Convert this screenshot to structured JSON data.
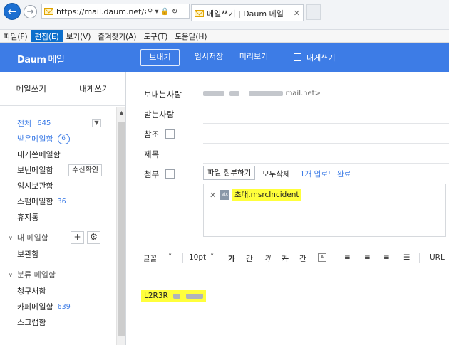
{
  "browser": {
    "address_url": "https://mail.daum.net/#?comp",
    "tab_title": "메일쓰기 | Daum 메일",
    "menu": [
      "파일(F)",
      "편집(E)",
      "보기(V)",
      "즐겨찾기(A)",
      "도구(T)",
      "도움말(H)"
    ],
    "active_menu_index": 1
  },
  "header": {
    "logo": "Daum",
    "logo_suffix": "메일",
    "send": "보내기",
    "save_draft": "임시저장",
    "preview": "미리보기",
    "send_to_self": "내게쓰기"
  },
  "sidebar": {
    "write_mail": "메일쓰기",
    "write_to_self": "내게쓰기",
    "total_label": "전체",
    "total_count": "645",
    "folders": [
      {
        "label": "받은메일함",
        "count": "6"
      },
      {
        "label": "내게쓴메일함"
      },
      {
        "label": "보낸메일함",
        "action": "수신확인"
      },
      {
        "label": "임시보관함"
      },
      {
        "label": "스팸메일함",
        "count": "36"
      },
      {
        "label": "휴지통"
      }
    ],
    "my_group": "내 메일함",
    "my_folders": [
      "보관함"
    ],
    "category_group": "분류 메일함",
    "category_folders": [
      {
        "label": "청구서함"
      },
      {
        "label": "카페메일함",
        "count": "639"
      },
      {
        "label": "스크랩함"
      }
    ]
  },
  "compose": {
    "from_label": "보내는사람",
    "from_value": "mail.net>",
    "to_label": "받는사람",
    "cc_label": "참조",
    "subject_label": "제목",
    "attach_label": "첨부",
    "attach_button": "파일 첨부하기",
    "delete_all": "모두삭제",
    "upload_status": "1개 업로드 완료",
    "file_name": "초대.msrcIncident",
    "file_type": "etc",
    "body_text": "L2R3R"
  },
  "editor_toolbar": {
    "font": "글꼴",
    "size": "10pt",
    "bold": "가",
    "underline": "간",
    "italic": "가",
    "strike": "가",
    "font_color": "간",
    "url": "URL"
  }
}
